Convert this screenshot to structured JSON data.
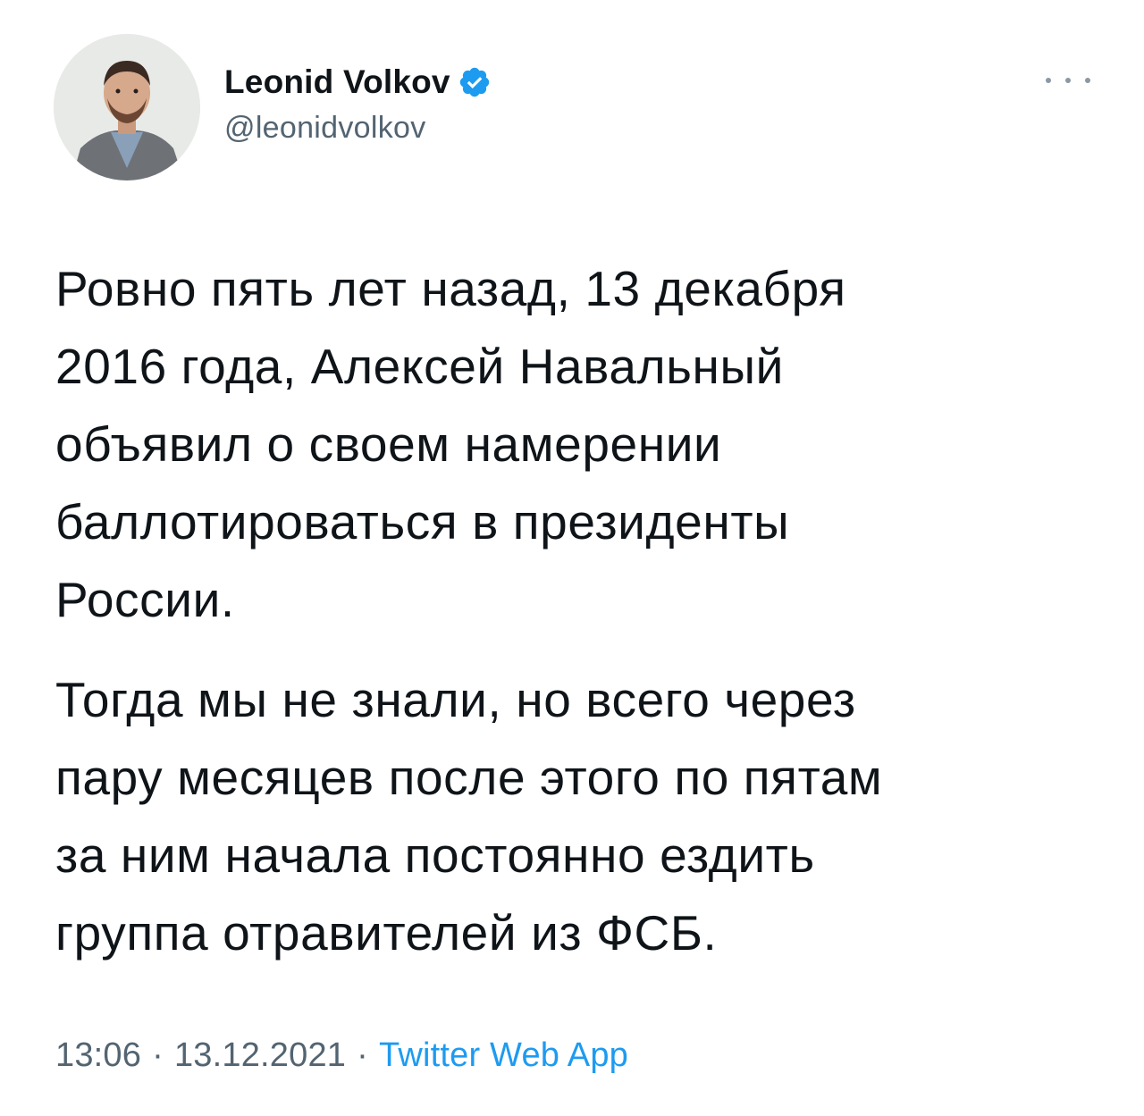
{
  "author": {
    "name": "Leonid Volkov",
    "handle": "@leonidvolkov",
    "verified": true
  },
  "tweet": {
    "paragraphs": [
      {
        "lines": [
          "Ровно пять лет назад, 13 декабря",
          "2016 года, Алексей Навальный",
          "объявил о своем намерении",
          "баллотироваться в президенты",
          "России."
        ]
      },
      {
        "lines": [
          "Тогда мы не знали, но всего через",
          "пару месяцев после этого по пятам",
          "за ним начала постоянно ездить",
          "группа отравителей из ФСБ."
        ]
      }
    ]
  },
  "meta": {
    "time": "13:06",
    "separator": "·",
    "date": "13.12.2021",
    "source": "Twitter Web App"
  },
  "icons": {
    "verified": "verified-badge-icon",
    "more": "more-horizontal-icon"
  },
  "colors": {
    "text": "#0f1419",
    "secondary": "#536471",
    "accent": "#1d9bf0"
  }
}
